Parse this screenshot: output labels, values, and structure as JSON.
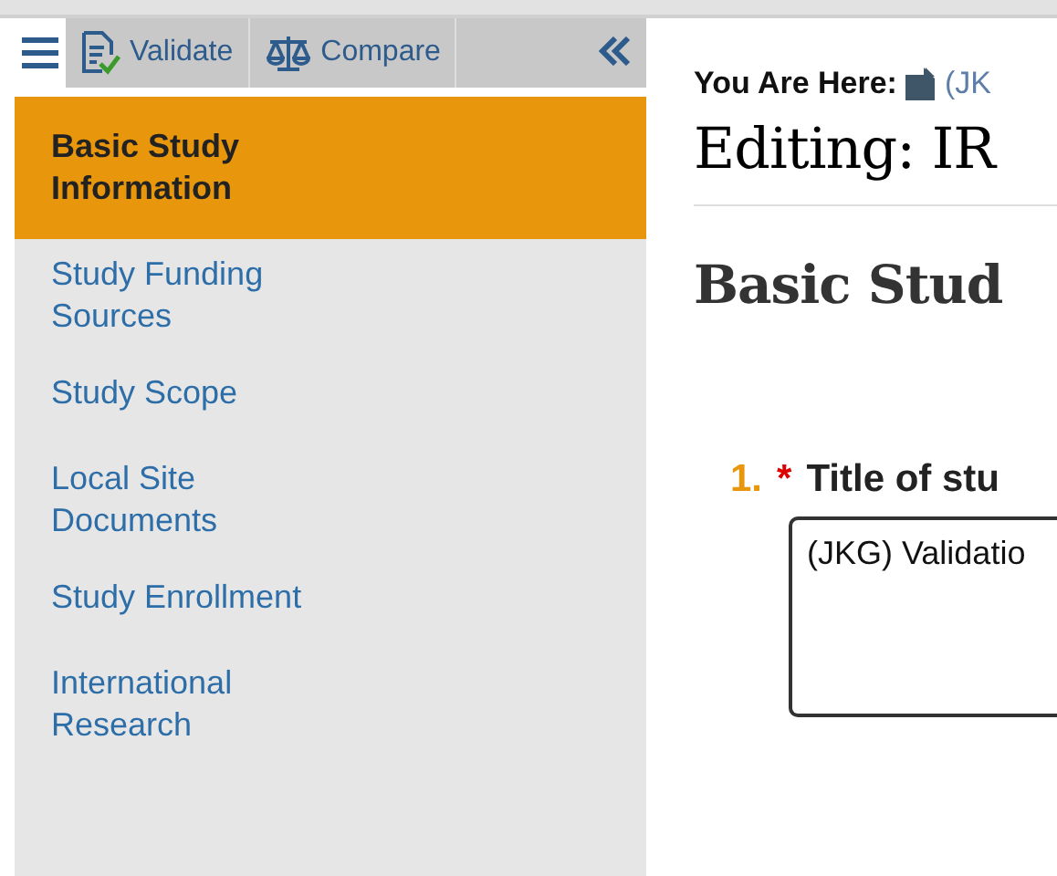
{
  "toolbar": {
    "buttons": [
      {
        "kind": "validate",
        "label": "Validate"
      },
      {
        "kind": "compare",
        "label": "Compare"
      }
    ]
  },
  "sidebar": {
    "items": [
      {
        "label": "Basic Study Information",
        "selected": true
      },
      {
        "label": "Study Funding Sources",
        "selected": false
      },
      {
        "label": "Study Scope",
        "selected": false
      },
      {
        "label": "Local Site Documents",
        "selected": false
      },
      {
        "label": "Study Enrollment",
        "selected": false
      },
      {
        "label": "International Research",
        "selected": false
      }
    ]
  },
  "breadcrumb": {
    "label": "You Are Here:",
    "link": "(JK"
  },
  "page_title": "Editing: IR",
  "section_title": "Basic Stud",
  "questions": [
    {
      "number": "1.",
      "required_mark": "*",
      "label": "Title of stu",
      "value": "(JKG) Validatio"
    }
  ]
}
